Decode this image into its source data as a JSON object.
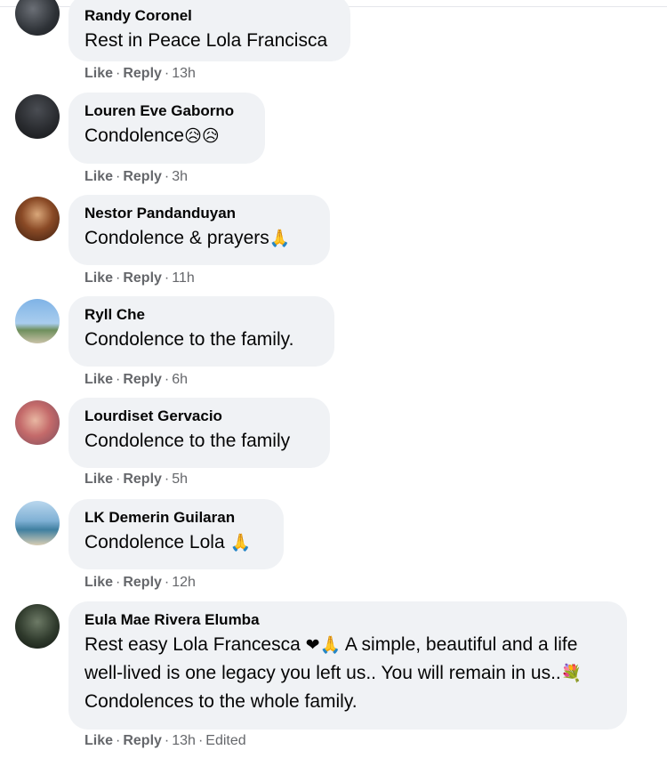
{
  "labels": {
    "like": "Like",
    "reply": "Reply",
    "separator": "·"
  },
  "comments": [
    {
      "author": "Randy Coronel",
      "text": "Rest in Peace Lola Francisca",
      "emoji": "",
      "time": "13h",
      "edited": ""
    },
    {
      "author": "Louren Eve Gaborno",
      "text": "Condolence",
      "emoji": "😥😥",
      "time": "3h",
      "edited": ""
    },
    {
      "author": "Nestor Pandanduyan",
      "text": "Condolence & prayers",
      "emoji": "🙏",
      "time": "11h",
      "edited": ""
    },
    {
      "author": "Ryll Che",
      "text": "Condolence to the family.",
      "emoji": "",
      "time": "6h",
      "edited": ""
    },
    {
      "author": "Lourdiset Gervacio",
      "text": "Condolence to the family",
      "emoji": "",
      "time": "5h",
      "edited": ""
    },
    {
      "author": "LK Demerin Guilaran",
      "text": "Condolence Lola ",
      "emoji": "🙏",
      "time": "12h",
      "edited": ""
    },
    {
      "author": "Eula Mae Rivera Elumba",
      "text_part1": "Rest easy Lola Francesca ",
      "emoji1": "❤🙏",
      "text_part2": " A simple, beautiful and a life well-lived is one legacy you left us.. You will remain in us..",
      "emoji2": "💐",
      "text_part3": " Condolences to the whole family.",
      "time": "13h",
      "edited": "Edited"
    }
  ]
}
